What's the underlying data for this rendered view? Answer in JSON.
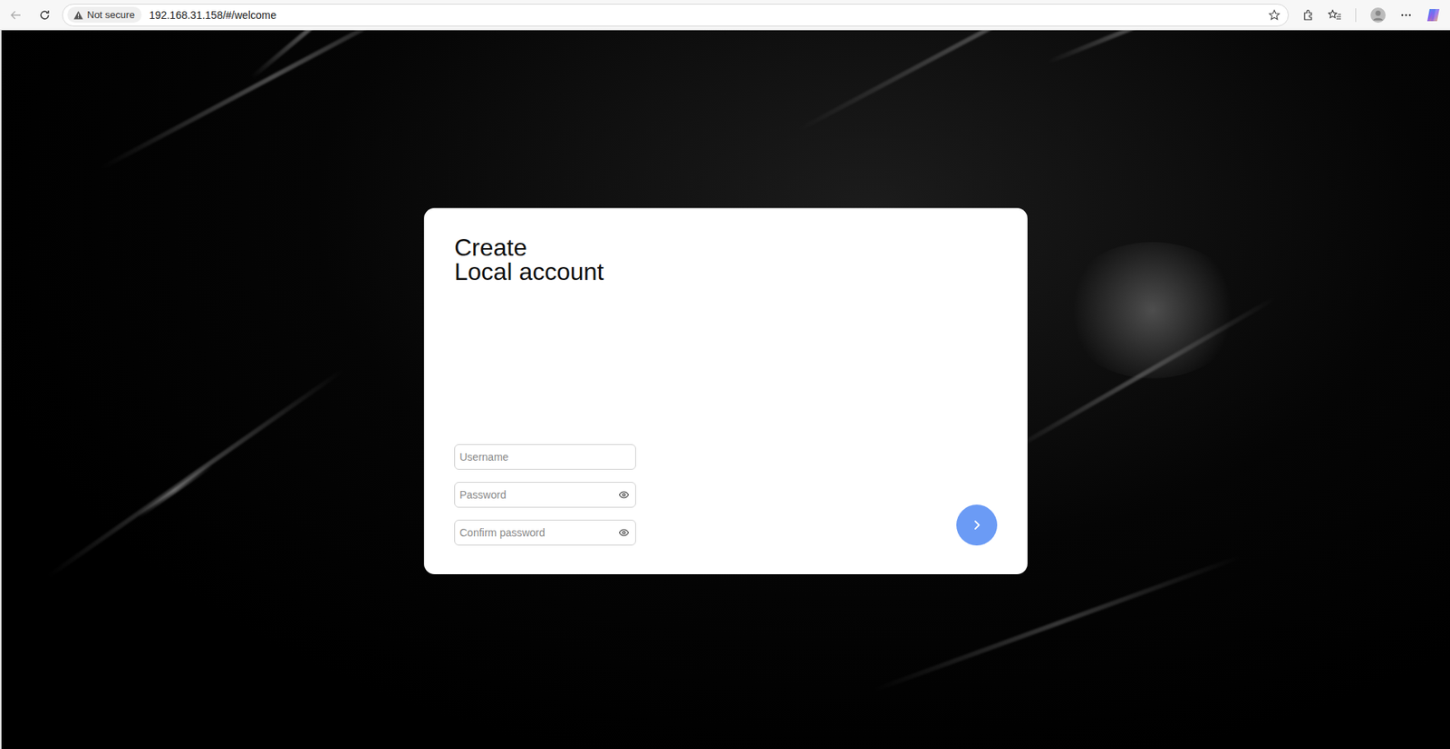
{
  "browser": {
    "address": "192.168.31.158/#/welcome",
    "security": "Not secure",
    "can_go_back": false
  },
  "card": {
    "title": [
      "Create",
      "Local account"
    ],
    "fields": [
      {
        "kind": "text",
        "placeholder": "Username",
        "value": ""
      },
      {
        "kind": "password",
        "placeholder": "Password",
        "value": ""
      },
      {
        "kind": "password",
        "placeholder": "Confirm password",
        "value": ""
      }
    ],
    "next_button": {
      "disabled": true
    }
  }
}
